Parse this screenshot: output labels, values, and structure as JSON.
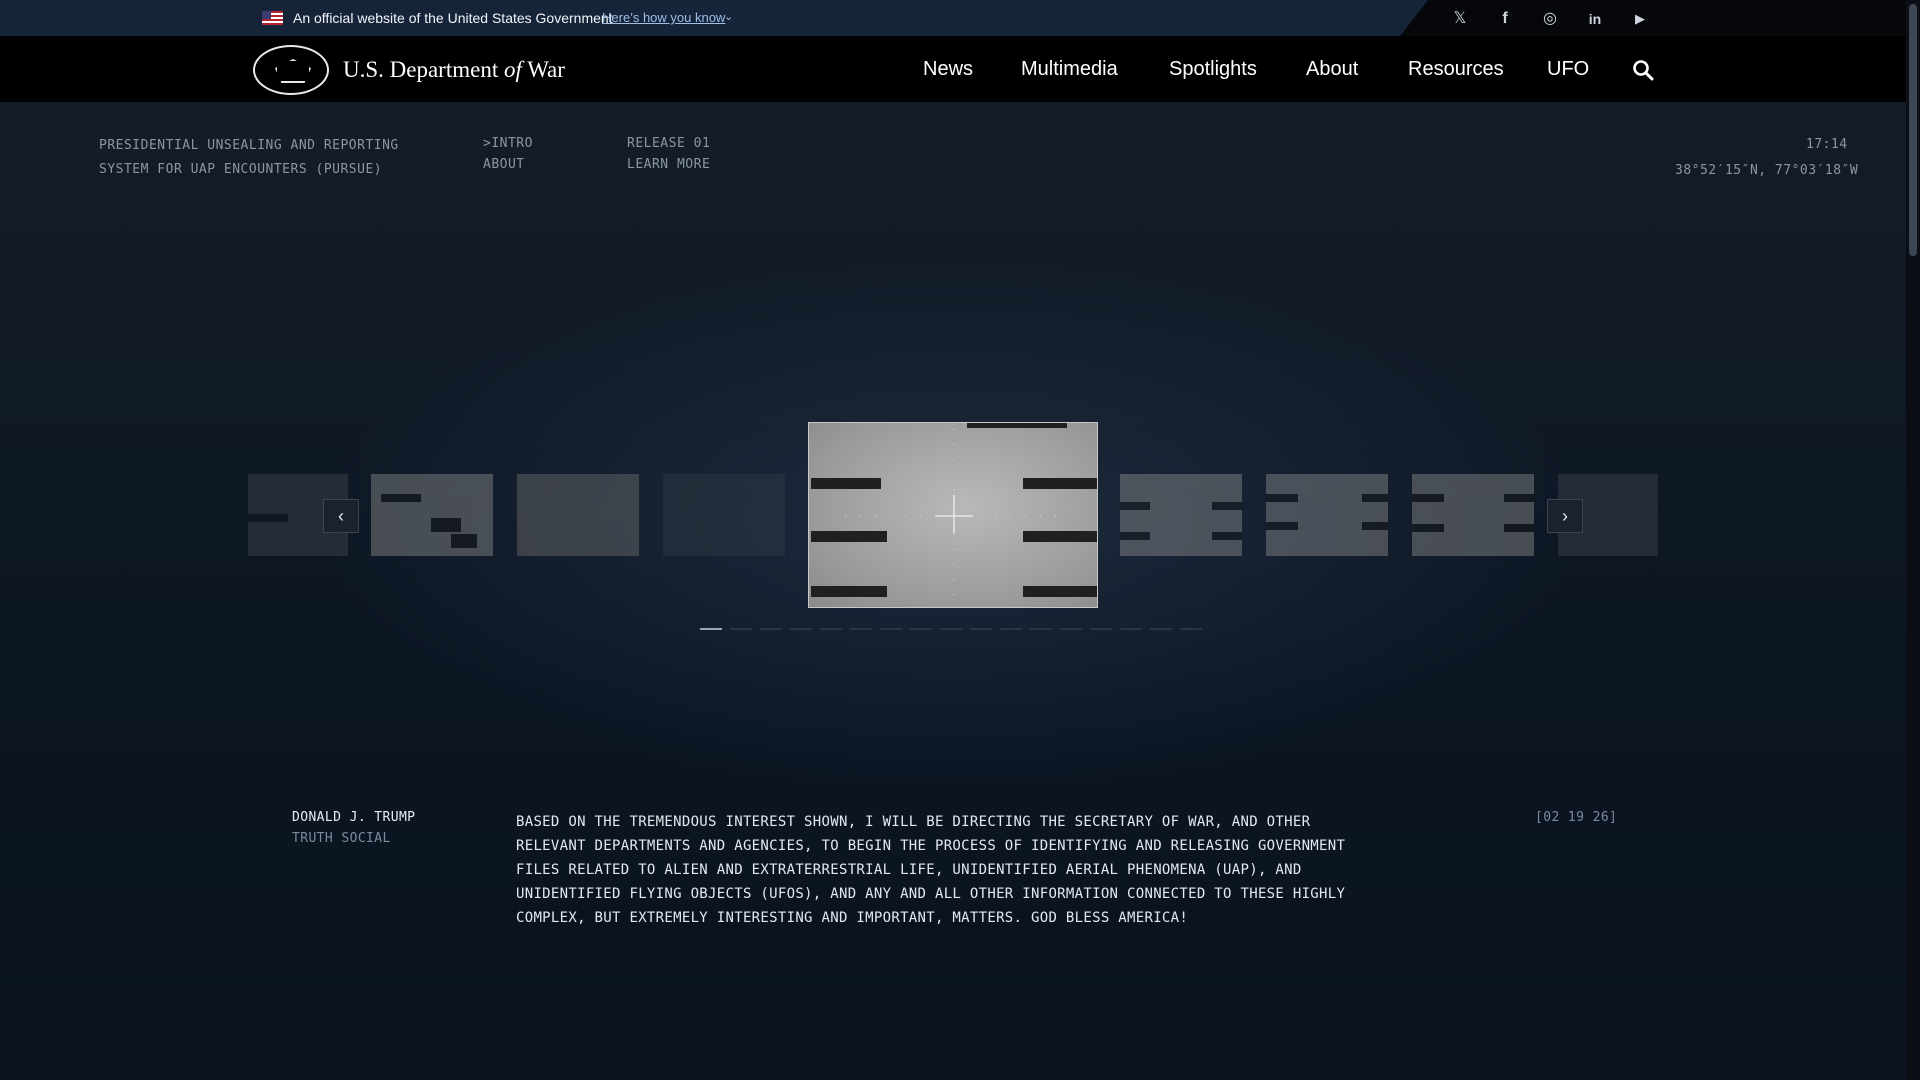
{
  "gov_banner": {
    "official_text": "An official website of the United States Government",
    "how_you_know": "Here’s how you know"
  },
  "social": [
    {
      "icon": "x-icon",
      "glyph": "𝕏"
    },
    {
      "icon": "facebook-icon",
      "glyph": "f"
    },
    {
      "icon": "instagram-icon",
      "glyph": "◎"
    },
    {
      "icon": "linkedin-icon",
      "glyph": "in"
    },
    {
      "icon": "youtube-icon",
      "glyph": "▶"
    }
  ],
  "header": {
    "title_prefix": "U.S. Department ",
    "title_of": "of",
    "title_suffix": " War",
    "nav": [
      "News",
      "Multimedia",
      "Spotlights",
      "About",
      "Resources",
      "UFO"
    ]
  },
  "hud": {
    "program_line1": "PRESIDENTIAL UNSEALING AND REPORTING",
    "program_line2": "SYSTEM FOR UAP ENCOUNTERS (PURSUE)",
    "intro": ">INTRO",
    "about": "ABOUT",
    "release": "RELEASE 01",
    "learn_more": "LEARN MORE",
    "time": "17:14",
    "coords": "38°52′15″N, 77°03′18″W"
  },
  "carousel": {
    "prev": "‹",
    "next": "›",
    "slide_count": 17,
    "active_slide": 1
  },
  "quote": {
    "name": "DONALD J. TRUMP",
    "source": "TRUTH SOCIAL",
    "text": "BASED ON THE TREMENDOUS INTEREST SHOWN, I WILL BE DIRECTING THE SECRETARY OF WAR, AND OTHER RELEVANT DEPARTMENTS AND AGENCIES, TO BEGIN THE PROCESS OF IDENTIFYING AND RELEASING GOVERNMENT FILES RELATED TO ALIEN AND EXTRATERRESTRIAL LIFE, UNIDENTIFIED AERIAL PHENOMENA (UAP), AND UNIDENTIFIED FLYING OBJECTS (UFOS), AND ANY AND ALL OTHER INFORMATION CONNECTED TO THESE HIGHLY COMPLEX, BUT EXTREMELY INTERESTING AND IMPORTANT, MATTERS. GOD BLESS AMERICA!",
    "date": "[02 19 26]"
  }
}
